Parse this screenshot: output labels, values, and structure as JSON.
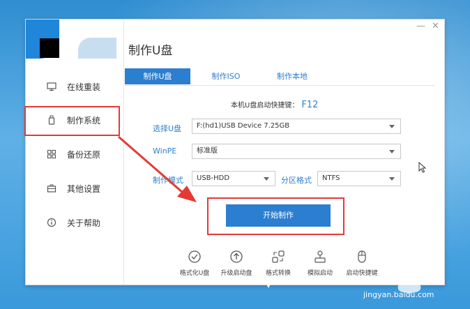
{
  "app": {
    "title": "制作U盘"
  },
  "sidebar": {
    "items": [
      {
        "label": "在线重装",
        "icon": "monitor-icon"
      },
      {
        "label": "制作系统",
        "icon": "usb-drive-icon",
        "active": true
      },
      {
        "label": "备份还原",
        "icon": "grid-icon"
      },
      {
        "label": "其他设置",
        "icon": "briefcase-icon"
      },
      {
        "label": "关于帮助",
        "icon": "info-icon"
      }
    ]
  },
  "window_controls": {
    "minimize": "—",
    "close": "✕"
  },
  "tabs": [
    {
      "label": "制作U盘",
      "active": true
    },
    {
      "label": "制作ISO",
      "active": false
    },
    {
      "label": "制作本地",
      "active": false
    }
  ],
  "hotkey": {
    "text": "本机U盘启动快捷键：",
    "key": "F12"
  },
  "form": {
    "usb": {
      "label": "选择U盘",
      "value": "F:(hd1)USB Device 7.25GB"
    },
    "winpe": {
      "label": "WinPE",
      "value": "标准版"
    },
    "mode": {
      "label": "制作模式",
      "value": "USB-HDD"
    },
    "partition": {
      "label": "分区格式",
      "value": "NTFS"
    }
  },
  "start_button": {
    "label": "开始制作"
  },
  "tools": [
    {
      "label": "格式化U盘",
      "icon": "check-circle-icon"
    },
    {
      "label": "升级启动盘",
      "icon": "upload-circle-icon"
    },
    {
      "label": "格式转换",
      "icon": "convert-icon"
    },
    {
      "label": "模拟启动",
      "icon": "simulate-icon"
    },
    {
      "label": "启动快捷键",
      "icon": "mouse-icon"
    }
  ],
  "watermark": {
    "text": "jingyan.baidu.com",
    "logo": "baidu-paw-icon"
  },
  "colors": {
    "accent": "#2c7ed0",
    "highlight": "#e53935"
  }
}
